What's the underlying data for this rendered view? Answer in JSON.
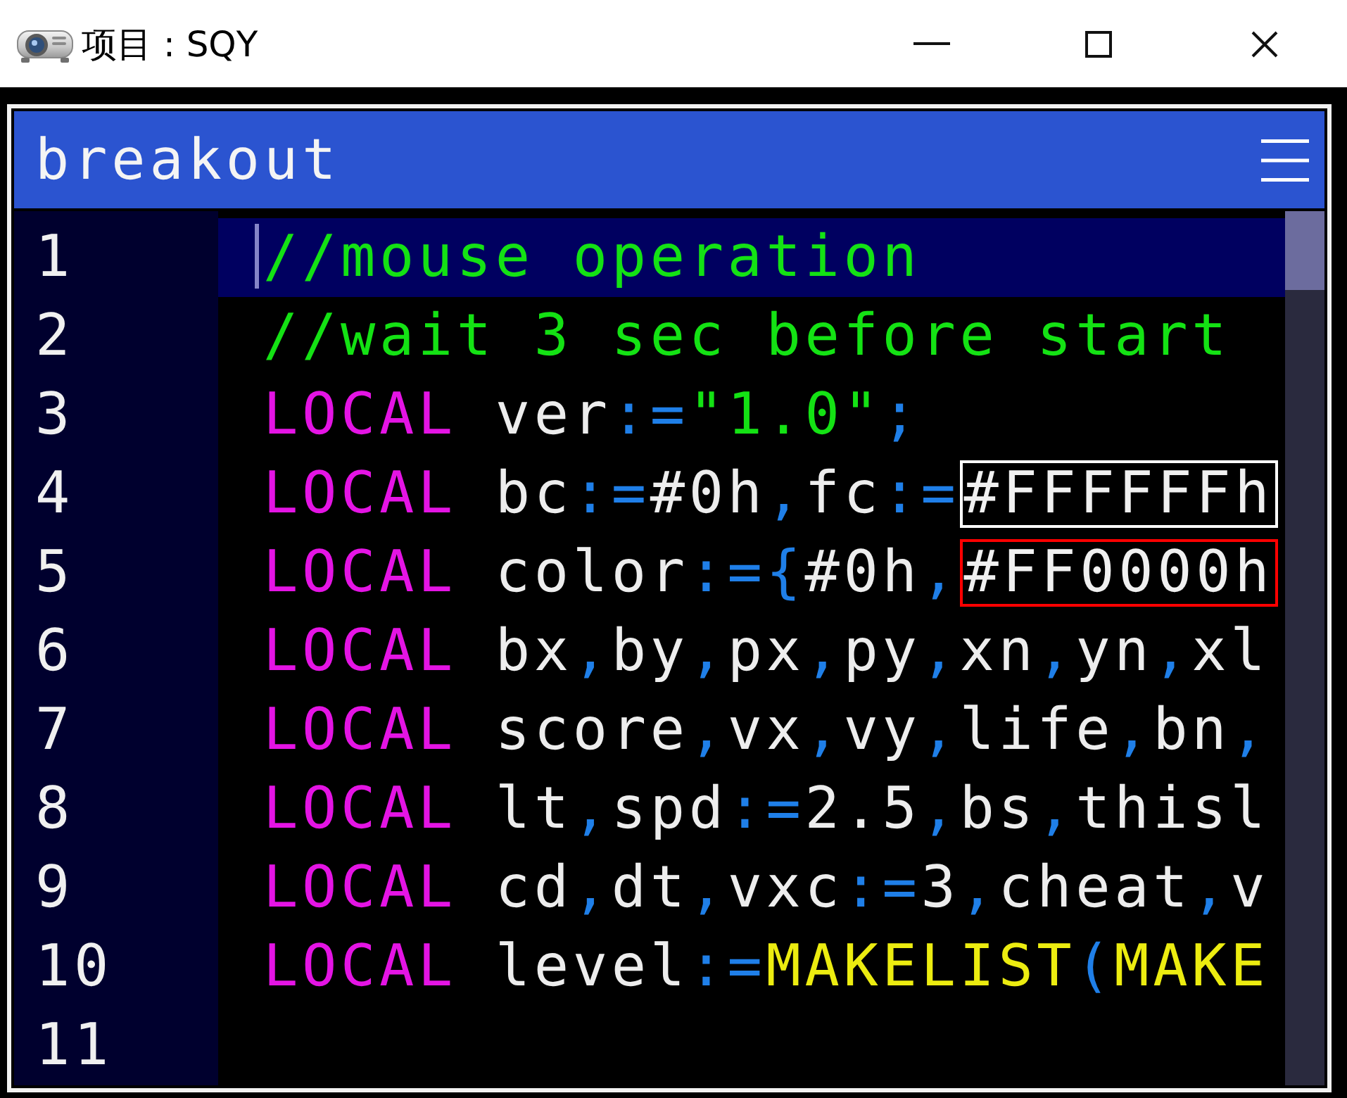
{
  "window": {
    "title": "项目 : SQY"
  },
  "editor": {
    "title": "breakout",
    "lines": [
      {
        "number": "1",
        "current": true,
        "tokens": [
          {
            "kind": "comment",
            "text": "//mouse operation"
          }
        ]
      },
      {
        "number": "2",
        "current": false,
        "tokens": [
          {
            "kind": "comment",
            "text": "//wait 3 sec before start"
          }
        ]
      },
      {
        "number": "3",
        "current": false,
        "tokens": [
          {
            "kind": "keyword",
            "text": "LOCAL"
          },
          {
            "kind": "plain",
            "text": " ver"
          },
          {
            "kind": "operator",
            "text": ":="
          },
          {
            "kind": "string",
            "text": "\"1.0\""
          },
          {
            "kind": "operator",
            "text": ";"
          }
        ]
      },
      {
        "number": "4",
        "current": false,
        "tokens": [
          {
            "kind": "keyword",
            "text": "LOCAL"
          },
          {
            "kind": "plain",
            "text": " bc"
          },
          {
            "kind": "operator",
            "text": ":="
          },
          {
            "kind": "plain",
            "text": "#0h"
          },
          {
            "kind": "operator",
            "text": ","
          },
          {
            "kind": "plain",
            "text": "fc"
          },
          {
            "kind": "operator",
            "text": ":="
          },
          {
            "kind": "color",
            "text": "#FFFFFFh",
            "color": "#ffffff"
          }
        ]
      },
      {
        "number": "5",
        "current": false,
        "tokens": [
          {
            "kind": "keyword",
            "text": "LOCAL"
          },
          {
            "kind": "plain",
            "text": " color"
          },
          {
            "kind": "operator",
            "text": ":={"
          },
          {
            "kind": "plain",
            "text": "#0h"
          },
          {
            "kind": "operator",
            "text": ","
          },
          {
            "kind": "color",
            "text": "#FF0000h",
            "color": "#ff0000"
          }
        ]
      },
      {
        "number": "6",
        "current": false,
        "tokens": [
          {
            "kind": "keyword",
            "text": "LOCAL"
          },
          {
            "kind": "plain",
            "text": " bx"
          },
          {
            "kind": "operator",
            "text": ","
          },
          {
            "kind": "plain",
            "text": "by"
          },
          {
            "kind": "operator",
            "text": ","
          },
          {
            "kind": "plain",
            "text": "px"
          },
          {
            "kind": "operator",
            "text": ","
          },
          {
            "kind": "plain",
            "text": "py"
          },
          {
            "kind": "operator",
            "text": ","
          },
          {
            "kind": "plain",
            "text": "xn"
          },
          {
            "kind": "operator",
            "text": ","
          },
          {
            "kind": "plain",
            "text": "yn"
          },
          {
            "kind": "operator",
            "text": ","
          },
          {
            "kind": "plain",
            "text": "xl"
          }
        ]
      },
      {
        "number": "7",
        "current": false,
        "tokens": [
          {
            "kind": "keyword",
            "text": "LOCAL"
          },
          {
            "kind": "plain",
            "text": " score"
          },
          {
            "kind": "operator",
            "text": ","
          },
          {
            "kind": "plain",
            "text": "vx"
          },
          {
            "kind": "operator",
            "text": ","
          },
          {
            "kind": "plain",
            "text": "vy"
          },
          {
            "kind": "operator",
            "text": ","
          },
          {
            "kind": "plain",
            "text": "life"
          },
          {
            "kind": "operator",
            "text": ","
          },
          {
            "kind": "plain",
            "text": "bn"
          },
          {
            "kind": "operator",
            "text": ","
          }
        ]
      },
      {
        "number": "8",
        "current": false,
        "tokens": [
          {
            "kind": "keyword",
            "text": "LOCAL"
          },
          {
            "kind": "plain",
            "text": " lt"
          },
          {
            "kind": "operator",
            "text": ","
          },
          {
            "kind": "plain",
            "text": "spd"
          },
          {
            "kind": "operator",
            "text": ":="
          },
          {
            "kind": "plain",
            "text": "2.5"
          },
          {
            "kind": "operator",
            "text": ","
          },
          {
            "kind": "plain",
            "text": "bs"
          },
          {
            "kind": "operator",
            "text": ","
          },
          {
            "kind": "plain",
            "text": "thisl"
          }
        ]
      },
      {
        "number": "9",
        "current": false,
        "tokens": [
          {
            "kind": "keyword",
            "text": "LOCAL"
          },
          {
            "kind": "plain",
            "text": " cd"
          },
          {
            "kind": "operator",
            "text": ","
          },
          {
            "kind": "plain",
            "text": "dt"
          },
          {
            "kind": "operator",
            "text": ","
          },
          {
            "kind": "plain",
            "text": "vxc"
          },
          {
            "kind": "operator",
            "text": ":="
          },
          {
            "kind": "plain",
            "text": "3"
          },
          {
            "kind": "operator",
            "text": ","
          },
          {
            "kind": "plain",
            "text": "cheat"
          },
          {
            "kind": "operator",
            "text": ","
          },
          {
            "kind": "plain",
            "text": "v"
          }
        ]
      },
      {
        "number": "10",
        "current": false,
        "tokens": [
          {
            "kind": "keyword",
            "text": "LOCAL"
          },
          {
            "kind": "plain",
            "text": " level"
          },
          {
            "kind": "operator",
            "text": ":="
          },
          {
            "kind": "function",
            "text": "MAKELIST"
          },
          {
            "kind": "operator",
            "text": "("
          },
          {
            "kind": "function",
            "text": "MAKE"
          }
        ]
      },
      {
        "number": "11",
        "current": false
      }
    ]
  }
}
